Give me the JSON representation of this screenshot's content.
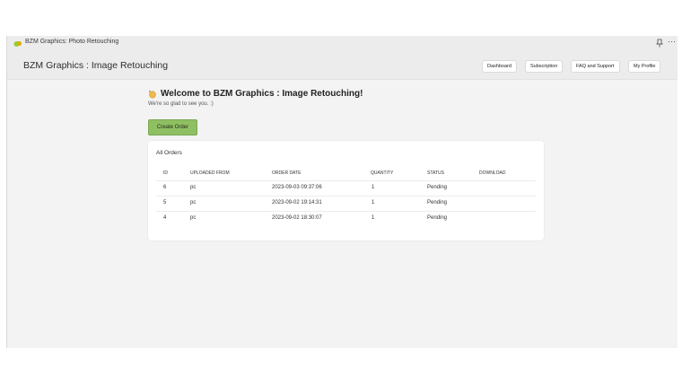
{
  "titlebar": {
    "title": "BZM Graphics: Photo Retouching",
    "more": "···"
  },
  "header": {
    "brand": "BZM Graphics : Image Retouching",
    "nav": [
      "Dashboard",
      "Subscription",
      "FAQ and Support",
      "My Profile"
    ]
  },
  "main": {
    "welcome": "Welcome to BZM Graphics : Image Retouching!",
    "subtitle": "We're so glad to see you. :)",
    "create_order": "Create Order"
  },
  "orders": {
    "title": "All Orders",
    "columns": [
      "ID",
      "UPLOADED FROM",
      "ORDER DATE",
      "QUANTITY",
      "STATUS",
      "DOWNLOAD"
    ],
    "rows": [
      {
        "id": "6",
        "uploaded_from": "pc",
        "order_date": "2023-09-03 09:37:06",
        "quantity": "1",
        "status": "Pending",
        "download": ""
      },
      {
        "id": "5",
        "uploaded_from": "pc",
        "order_date": "2023-09-02 19:14:31",
        "quantity": "1",
        "status": "Pending",
        "download": ""
      },
      {
        "id": "4",
        "uploaded_from": "pc",
        "order_date": "2023-09-02 18:30:07",
        "quantity": "1",
        "status": "Pending",
        "download": ""
      }
    ]
  },
  "colors": {
    "accent_green": "#8fbf63",
    "background": "#f3f3f3"
  }
}
